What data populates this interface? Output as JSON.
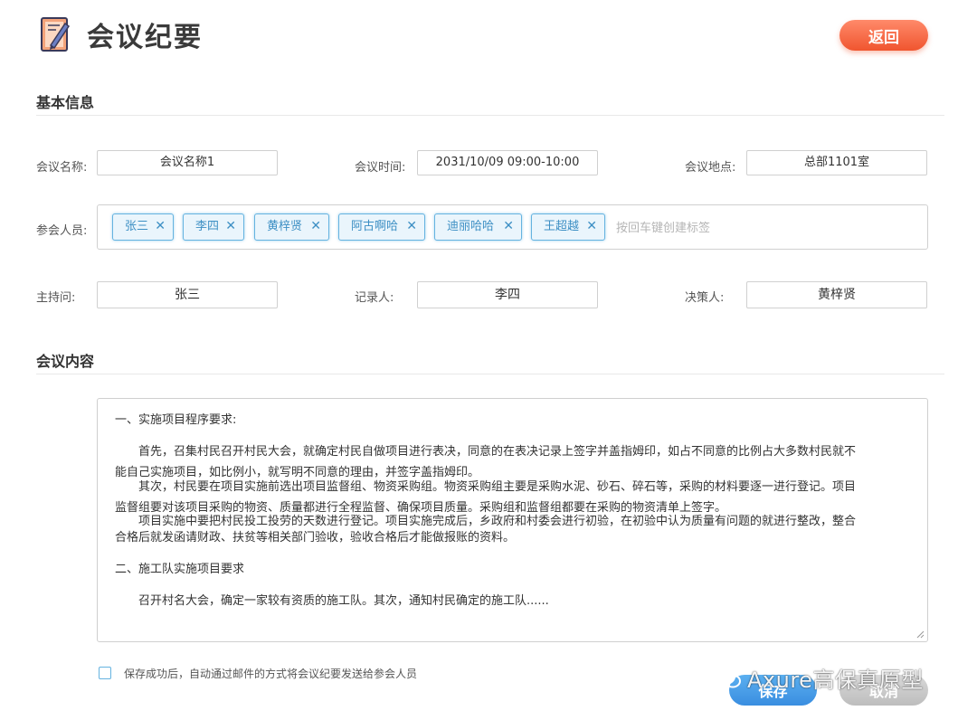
{
  "header": {
    "title": "会议纪要",
    "back_label": "返回"
  },
  "sections": {
    "basic_info": "基本信息",
    "content": "会议内容"
  },
  "fields": {
    "name": {
      "label": "会议名称:",
      "value": "会议名称1"
    },
    "time": {
      "label": "会议时间:",
      "value": "2031/10/09 09:00-10:00"
    },
    "location": {
      "label": "会议地点:",
      "value": "总部1101室"
    },
    "attendees": {
      "label": "参会人员:",
      "tags": [
        "张三",
        "李四",
        "黄梓贤",
        "阿古啊哈",
        "迪丽哈哈",
        "王超越"
      ],
      "placeholder": "按回车键创建标签"
    },
    "host": {
      "label": "主持问:",
      "value": "张三"
    },
    "recorder": {
      "label": "记录人:",
      "value": "李四"
    },
    "decider": {
      "label": "决策人:",
      "value": "黄梓贤"
    }
  },
  "content": {
    "lines": [
      "一、实施项目程序要求:",
      "　　首先，召集村民召开村民大会，就确定村民自做项目进行表决，同意的在表决记录上签字并盖指姆印，如占不同意的比例占大多数村民就不",
      "能自己实施项目，如比例小，就写明不同意的理由，并签字盖指姆印。",
      "　　其次，村民要在项目实施前选出项目监督组、物资采购组。物资采购组主要是采购水泥、砂石、碎石等，采购的材料要逐一进行登记。项目",
      "监督组要对该项目采购的物资、质量都进行全程监督、确保项目质量。采购组和监督组都要在采购的物资清单上签字。",
      "　　项目实施中要把村民投工投劳的天数进行登记。项目实施完成后，乡政府和村委会进行初验，在初验中认为质量有问题的就进行整改，整合",
      "合格后就发函请财政、扶贫等相关部门验收，验收合格后才能做报账的资料。",
      "二、施工队实施项目要求",
      "　　召开村名大会，确定一家较有资质的施工队。其次，通知村民确定的施工队......"
    ]
  },
  "footer": {
    "checkbox_label": "保存成功后，自动通过邮件的方式将会议纪要发送给参会人员",
    "save_label": "保存",
    "cancel_label": "取消",
    "watermark": "Axure高保真原型"
  },
  "colors": {
    "accent_blue": "#3a8ee0",
    "tag_border": "#65b3e0",
    "back_button": "#f0552f"
  }
}
